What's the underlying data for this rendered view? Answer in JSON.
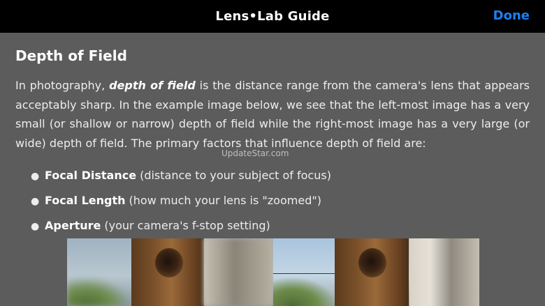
{
  "navbar": {
    "title": "Lens•Lab Guide",
    "done_label": "Done",
    "done_color": "#1e7ff0"
  },
  "section": {
    "title": "Depth of Field",
    "intro_before": "In photography, ",
    "intro_term": "depth of field",
    "intro_after": " is the distance range from the camera's lens that appears acceptably sharp. In the example image below, we see that the left-most image has a very small (or shallow or narrow) depth of field while the right-most image has a very large (or wide) depth of field. The primary factors that influence depth of field are:"
  },
  "watermark": "UpdateStar.com",
  "factors": [
    {
      "name": "Focal Distance",
      "desc": "(distance to your subject of focus)"
    },
    {
      "name": "Focal Length",
      "desc": "(how much your lens is \"zoomed\")"
    },
    {
      "name": "Aperture",
      "desc": "(your camera's f-stop setting)"
    }
  ],
  "colors": {
    "background": "#5c5c5c",
    "navbar": "#000000",
    "text": "#ffffff"
  }
}
